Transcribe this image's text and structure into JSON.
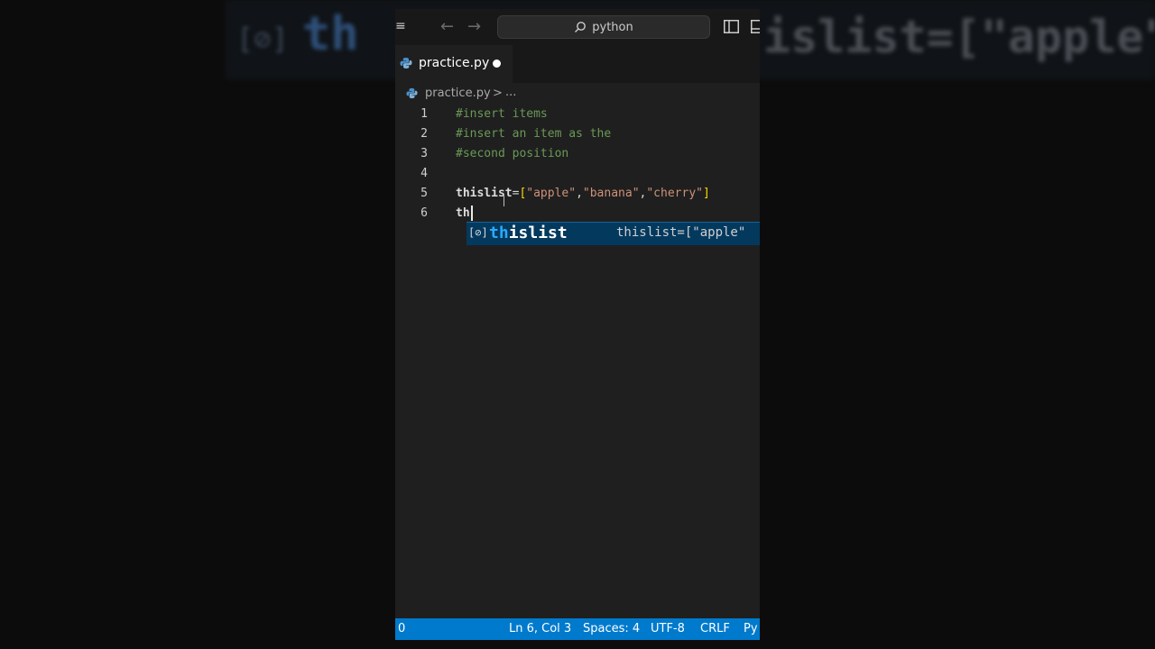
{
  "background": {
    "blur_left_text": "th",
    "blur_right_text": "islist=[\"apple\""
  },
  "titlebar": {
    "search_text": "python"
  },
  "tab": {
    "label": "practice.py"
  },
  "breadcrumb": {
    "file": "practice.py",
    "separator": ">",
    "ellipsis": "..."
  },
  "editor": {
    "lines": [
      {
        "number": "1",
        "text": "#insert items"
      },
      {
        "number": "2",
        "text": "#insert an item as the"
      },
      {
        "number": "3",
        "text": "#second position"
      },
      {
        "number": "4",
        "text": ""
      },
      {
        "number": "5",
        "var": "thislist",
        "eq": "=",
        "open": "[",
        "s1": "\"apple\"",
        "c1": ",",
        "s2": "\"banana\"",
        "c2": ",",
        "s3": "\"cherry\"",
        "close": "]"
      },
      {
        "number": "6",
        "text": "th"
      }
    ]
  },
  "suggestion": {
    "icon": "[⊘]",
    "match": "th",
    "rest": "islist",
    "detail": "thislist=[\"apple\""
  },
  "statusbar": {
    "errors": "0",
    "position": "Ln 6, Col 3",
    "spaces": "Spaces: 4",
    "encoding": "UTF-8",
    "eol": "CRLF",
    "language": "Py"
  },
  "colors": {
    "accent": "#007acc",
    "editor_bg": "#1f1f1f",
    "comment": "#6a9955",
    "string": "#ce9178",
    "suggest_bg": "#04395e",
    "suggest_match": "#2aaaff"
  }
}
